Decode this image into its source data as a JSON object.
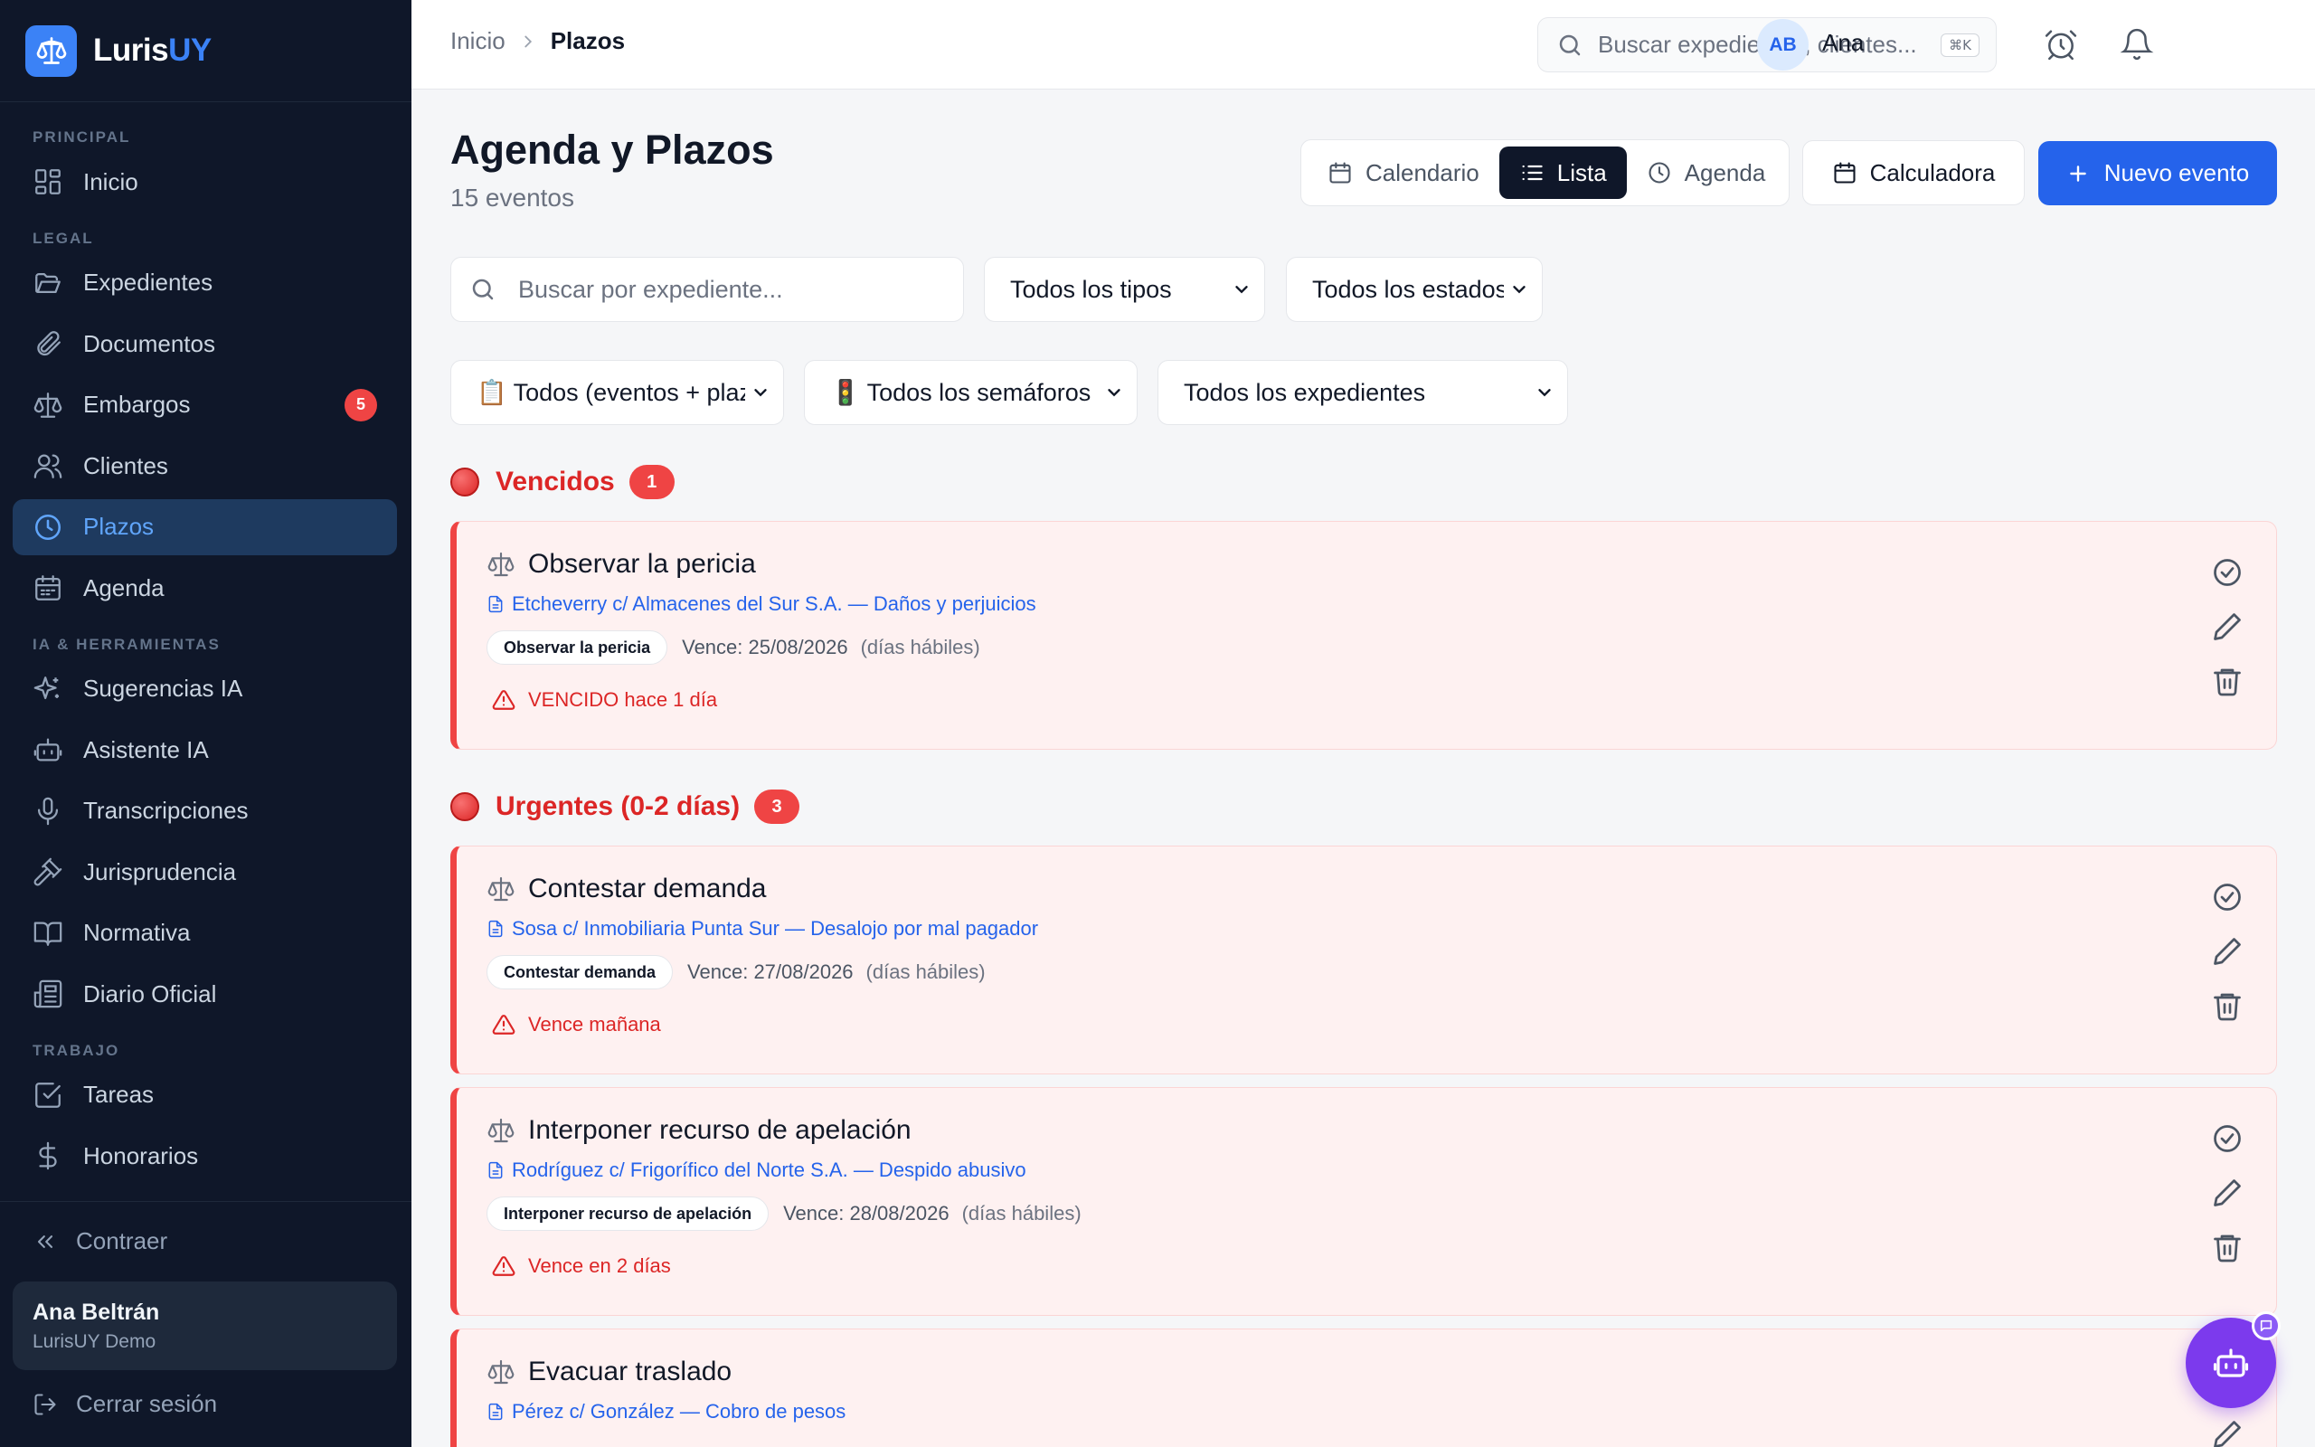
{
  "brand": {
    "name_main": "Luris",
    "name_accent": "UY"
  },
  "sidebar": {
    "sections": {
      "principal": "PRINCIPAL",
      "legal": "LEGAL",
      "ia": "IA & HERRAMIENTAS",
      "trabajo": "TRABAJO"
    },
    "items": {
      "inicio": "Inicio",
      "expedientes": "Expedientes",
      "documentos": "Documentos",
      "embargos": "Embargos",
      "embargos_badge": "5",
      "clientes": "Clientes",
      "plazos": "Plazos",
      "agenda": "Agenda",
      "sugerencias": "Sugerencias IA",
      "asistente": "Asistente IA",
      "transcripciones": "Transcripciones",
      "jurisprudencia": "Jurisprudencia",
      "normativa": "Normativa",
      "diario": "Diario Oficial",
      "tareas": "Tareas",
      "honorarios": "Honorarios"
    },
    "collapse_label": "Contraer",
    "user": {
      "name": "Ana Beltrán",
      "org": "LurisUY Demo"
    },
    "logout_label": "Cerrar sesión"
  },
  "topbar": {
    "breadcrumb": {
      "home": "Inicio",
      "current": "Plazos"
    },
    "search_placeholder": "Buscar expedientes, clientes...",
    "search_shortcut": "⌘K",
    "avatar_initials": "AB",
    "user_name": "Ana"
  },
  "page": {
    "title": "Agenda y Plazos",
    "subtitle": "15 eventos",
    "views": {
      "calendario": "Calendario",
      "lista": "Lista",
      "agenda": "Agenda"
    },
    "calculator_label": "Calculadora",
    "new_event_label": "Nuevo evento"
  },
  "filters": {
    "search_placeholder": "Buscar por expediente...",
    "type": "Todos los tipos",
    "status": "Todos los estados",
    "scope": "📋 Todos (eventos + plazos)",
    "semaphore": "🚦 Todos los semáforos",
    "case": "Todos los expedientes"
  },
  "groups": {
    "vencidos": {
      "label": "Vencidos",
      "count": "1"
    },
    "urgentes": {
      "label": "Urgentes (0-2 días)",
      "count": "3"
    }
  },
  "events": [
    {
      "title": "Observar la pericia",
      "case": "Etcheverry c/ Almacenes del Sur S.A. — Daños y perjuicios",
      "tag": "Observar la pericia",
      "due": "Vence: 25/08/2026",
      "days": "(días hábiles)",
      "alert": "VENCIDO hace 1 día"
    },
    {
      "title": "Contestar demanda",
      "case": "Sosa c/ Inmobiliaria Punta Sur — Desalojo por mal pagador",
      "tag": "Contestar demanda",
      "due": "Vence: 27/08/2026",
      "days": "(días hábiles)",
      "alert": "Vence mañana"
    },
    {
      "title": "Interponer recurso de apelación",
      "case": "Rodríguez c/ Frigorífico del Norte S.A. — Despido abusivo",
      "tag": "Interponer recurso de apelación",
      "due": "Vence: 28/08/2026",
      "days": "(días hábiles)",
      "alert": "Vence en 2 días"
    },
    {
      "title": "Evacuar traslado",
      "case": "Pérez c/ González — Cobro de pesos"
    }
  ]
}
